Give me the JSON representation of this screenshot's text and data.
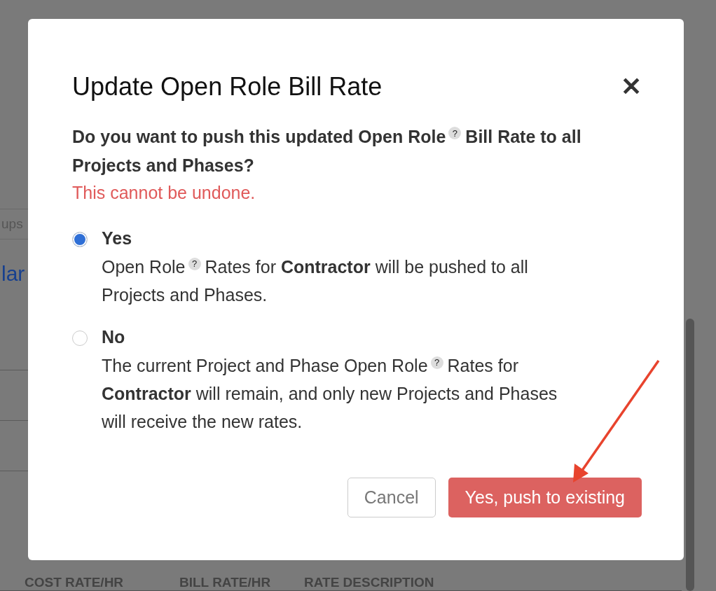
{
  "background": {
    "tab_fragment": "ups",
    "link_fragment": "lar",
    "columns": [
      "COST RATE/HR",
      "BILL RATE/HR",
      "RATE DESCRIPTION"
    ]
  },
  "dialog": {
    "title": "Update Open Role Bill Rate",
    "close": "✕",
    "question": {
      "before": "Do you want to push this updated Open Role",
      "hint": "?",
      "after": "Bill Rate to all Projects and Phases?"
    },
    "warning": "This cannot be undone.",
    "options": [
      {
        "label": "Yes",
        "selected": true,
        "before": "Open Role",
        "hint": "?",
        "after": "Rates for **Contractor** will be pushed to all Projects and Phases."
      },
      {
        "label": "No",
        "selected": false,
        "before": "The current Project and Phase Open Role",
        "hint": "?",
        "after": "Rates for **Contractor** will remain, and only new Projects and Phases will receive the new rates."
      }
    ],
    "buttons": [
      {
        "label": "Cancel",
        "kind": "secondary"
      },
      {
        "label": "Yes, push to existing",
        "kind": "primary"
      }
    ]
  }
}
